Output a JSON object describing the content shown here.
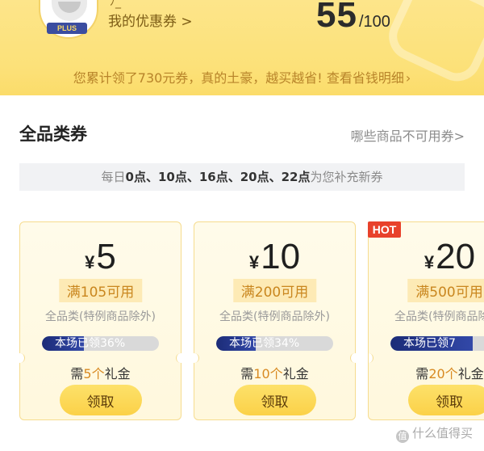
{
  "header": {
    "user_mark": "ﾉ_",
    "plus_badge": "PLUS",
    "coupon_link": "我的优惠券 >",
    "score_value": "55",
    "score_total": "/100",
    "summary_prefix": "您累计领了730元券，真的土豪，越买越省! ",
    "summary_link": "查看省钱明细",
    "summary_arrow": "›"
  },
  "section": {
    "title": "全品类券",
    "unavailable_link": "哪些商品不可用券>",
    "refresh_prefix": "每日",
    "refresh_times": "0点、10点、16点、20点、22点",
    "refresh_suffix": "为您补充新券"
  },
  "cards": [
    {
      "currency": "¥",
      "amount": "5",
      "threshold": "满105可用",
      "scope": "全品类(特例商品除外)",
      "progress_text": "本场已领36%",
      "progress": 0.36,
      "gift_prefix": "需",
      "gift_count": "5个",
      "gift_suffix": "礼金",
      "button": "领取"
    },
    {
      "currency": "¥",
      "amount": "10",
      "threshold": "满200可用",
      "scope": "全品类(特例商品除外)",
      "progress_text": "本场已领34%",
      "progress": 0.34,
      "gift_prefix": "需",
      "gift_count": "10个",
      "gift_suffix": "礼金",
      "button": "领取"
    },
    {
      "badge": "HOT",
      "currency": "¥",
      "amount": "20",
      "threshold": "满500可用",
      "scope": "全品类(特例商品除外)",
      "progress_text": "本场已领7",
      "progress": 0.7,
      "gift_prefix": "需",
      "gift_count": "20个",
      "gift_suffix": "礼金",
      "button": "领取"
    }
  ],
  "watermark": {
    "icon": "值",
    "text": "什么值得买"
  },
  "colors": {
    "header_bg": "#fce179",
    "accent_gold": "#c9861e",
    "progress_navy": "#1c2c78",
    "hot_red": "#e8412b",
    "button_yellow": "#fbd148"
  }
}
